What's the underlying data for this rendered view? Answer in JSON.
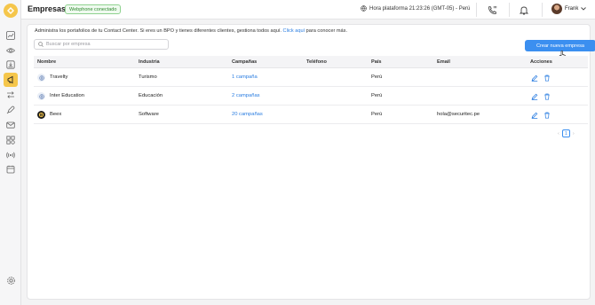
{
  "header": {
    "title": "Empresas",
    "status_badge": "Webphone conectado",
    "clock": "Hora plataforma 21:23:26 (GMT-05) - Perú",
    "user_name": "Frank"
  },
  "sidebar": {
    "items": [
      {
        "icon": "chart-line-icon"
      },
      {
        "icon": "eye-icon"
      },
      {
        "icon": "inbox-icon"
      },
      {
        "icon": "megaphone-icon",
        "active": true
      },
      {
        "icon": "arrows-exchange-icon"
      },
      {
        "icon": "rocket-icon"
      },
      {
        "icon": "mail-icon"
      },
      {
        "icon": "apps-grid-icon"
      },
      {
        "icon": "broadcast-icon"
      },
      {
        "icon": "calendar-icon"
      }
    ],
    "bottom_icon": "settings-icon"
  },
  "main": {
    "description": "Administra los portafolios de tu Contact Center. Si eres un BPO y tienes diferentes clientes, gestiona todos aquí.",
    "description_link": "Click aquí",
    "description_end": "para conocer más.",
    "search_placeholder": "Buscar por empresa",
    "create_button": "Crear nueva empresa",
    "table": {
      "headers": [
        "Nombre",
        "Industria",
        "Campañas",
        "Teléfono",
        "País",
        "Email",
        "Acciones"
      ],
      "rows": [
        {
          "name": "Travelty",
          "industry": "Turismo",
          "campaigns": "1 campaña",
          "phone": "",
          "country": "Perú",
          "email": ""
        },
        {
          "name": "Inter Education",
          "industry": "Educación",
          "campaigns": "2 campañas",
          "phone": "",
          "country": "Perú",
          "email": ""
        },
        {
          "name": "Beex",
          "industry": "Software",
          "campaigns": "20 campañas",
          "phone": "",
          "country": "Perú",
          "email": "hola@securitec.pe"
        }
      ]
    },
    "pagination": {
      "current_page": "1"
    }
  },
  "colors": {
    "accent": "#3b8ff0",
    "brand_yellow": "#f5c64b",
    "link": "#2a7de1",
    "badge_green": "#2f8a2f"
  }
}
